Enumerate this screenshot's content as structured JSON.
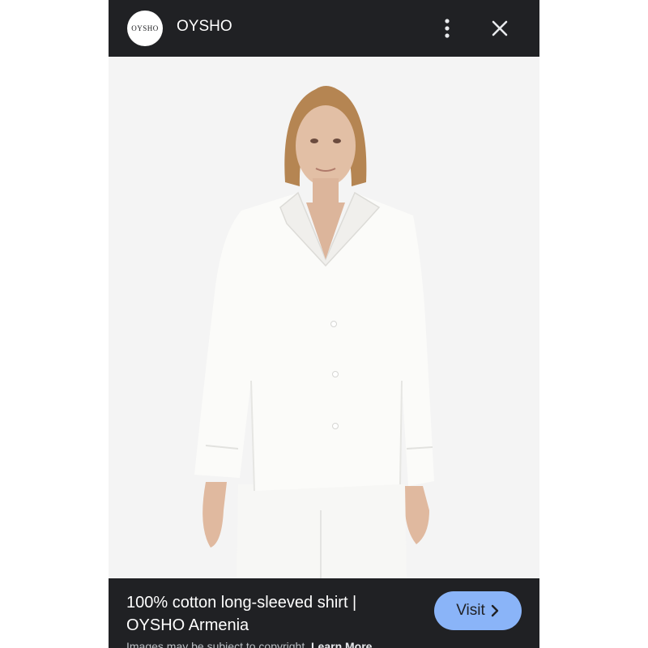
{
  "header": {
    "logo_text": "OYSHO",
    "brand_name": "OYSHO",
    "more_icon": "more-vert-icon",
    "close_icon": "close-icon"
  },
  "image": {
    "subject": "product-photo"
  },
  "footer": {
    "title_line1": "100% cotton long-sleeved shirt |",
    "title_line2": "OYSHO Armenia",
    "visit_label": "Visit",
    "visit_icon": "chevron-right-icon",
    "copyright_text": "Images may be subject to copyright.",
    "learn_more_label": "Learn More"
  },
  "colors": {
    "bar_bg": "#202124",
    "visit_bg": "#8ab4f8"
  }
}
